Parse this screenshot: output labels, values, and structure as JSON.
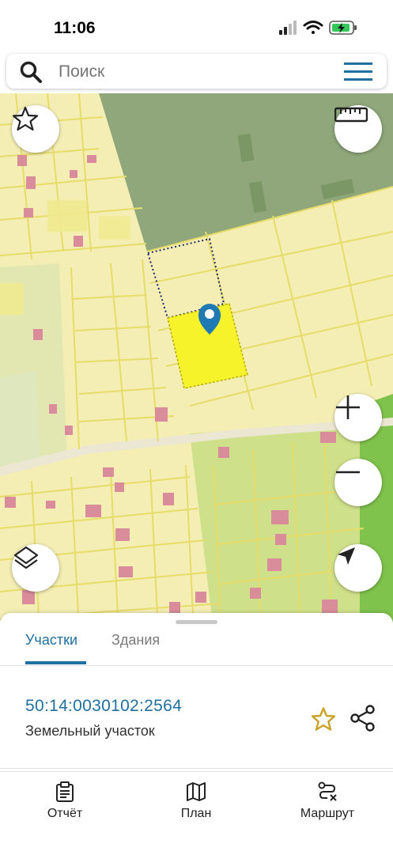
{
  "status_bar": {
    "time": "11:06"
  },
  "search": {
    "placeholder": "Поиск"
  },
  "sheet": {
    "tabs": [
      {
        "label": "Участки",
        "active": true
      },
      {
        "label": "Здания",
        "active": false
      }
    ],
    "parcel": {
      "number": "50:14:0030102:2564",
      "type": "Земельный участок"
    }
  },
  "nav": {
    "report": "Отчёт",
    "plan": "План",
    "route": "Маршрут"
  },
  "colors": {
    "accent": "#1f6f9f",
    "selected_parcel": "#f7f32b",
    "map_base": "#f4eeb4",
    "forest": "#8fa77b",
    "star": "#c9a227"
  },
  "icons": [
    "search-icon",
    "menu-icon",
    "favorite-icon",
    "ruler-icon",
    "zoom-in-icon",
    "zoom-out-icon",
    "layers-icon",
    "locate-icon",
    "map-pin-icon",
    "star-icon",
    "share-icon",
    "report-icon",
    "plan-icon",
    "route-icon"
  ]
}
